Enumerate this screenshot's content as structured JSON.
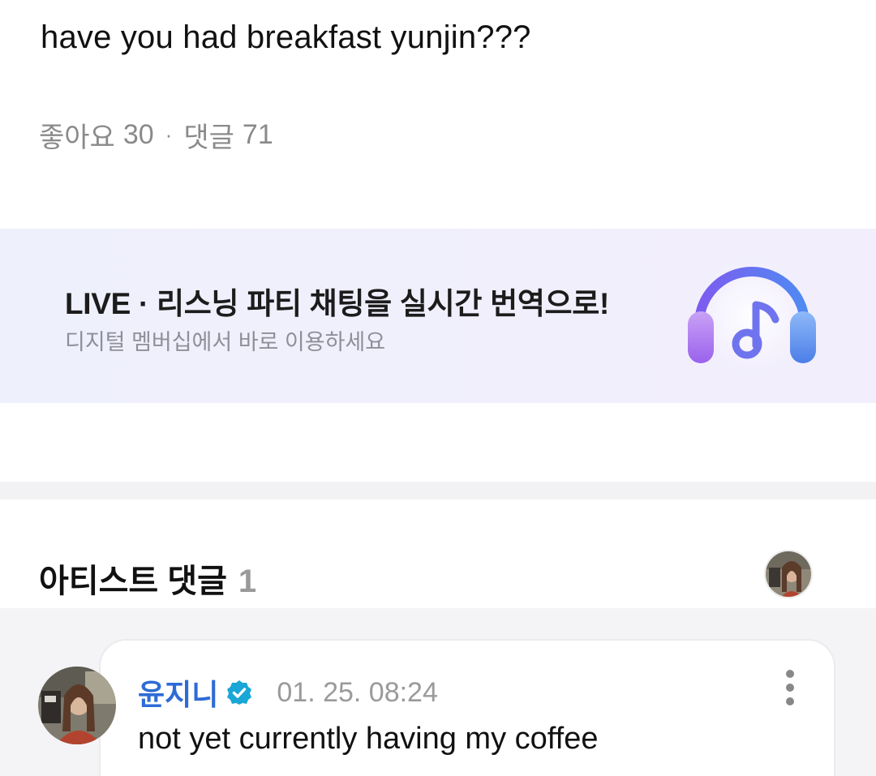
{
  "post": {
    "text": "have you had breakfast yunjin???",
    "likes_label": "좋아요",
    "likes_count": "30",
    "separator": "·",
    "comments_label": "댓글",
    "comments_count": "71"
  },
  "banner": {
    "title": "LIVE · 리스닝 파티 채팅을 실시간 번역으로!",
    "subtitle": "디지털 멤버십에서 바로 이용하세요",
    "icon": "headphones-music-icon"
  },
  "artist_comments": {
    "heading": "아티스트 댓글",
    "count": "1"
  },
  "comment": {
    "author": "윤지니",
    "verified_icon": "verified-badge-icon",
    "time": "01. 25. 08:24",
    "text": "not yet currently having my coffee",
    "more_icon": "more-vertical-icon"
  },
  "colors": {
    "author_blue": "#2e6bd6",
    "verified_teal": "#1aa6d6",
    "muted_gray": "#8a8a8a",
    "banner_bg": "#eef0fb",
    "divider_bg": "#f2f2f4"
  }
}
